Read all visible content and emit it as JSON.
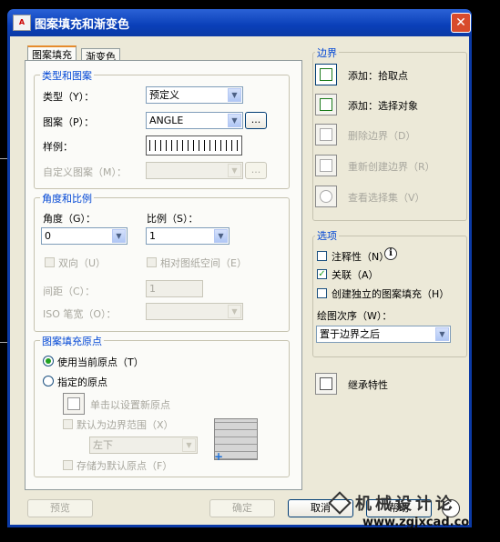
{
  "window": {
    "title": "图案填充和渐变色",
    "app_icon_text": "A"
  },
  "tabs": [
    {
      "label": "图案填充"
    },
    {
      "label": "渐变色"
    }
  ],
  "type_pattern": {
    "title": "类型和图案",
    "type_label": "类型（Y）：",
    "type_value": "预定义",
    "pattern_label": "图案（P）：",
    "pattern_value": "ANGLE",
    "pattern_browse": "...",
    "sample_label": "样例：",
    "custom_label": "自定义图案（M）：",
    "custom_browse": "..."
  },
  "angle_scale": {
    "title": "角度和比例",
    "angle_label": "角度（G）：",
    "angle_value": "0",
    "scale_label": "比例（S）：",
    "scale_value": "1",
    "double_label": "双向（U）",
    "relative_label": "相对图纸空间（E）",
    "spacing_label": "间距（C）：",
    "spacing_value": "1",
    "iso_label": "ISO 笔宽（O）："
  },
  "origin": {
    "title": "图案填充原点",
    "use_current": "使用当前原点（T）",
    "specified": "指定的原点",
    "click_set": "单击以设置新原点",
    "default_extent": "默认为边界范围（X）",
    "extent_value": "左下",
    "store_default": "存储为默认原点（F）"
  },
  "boundaries": {
    "title": "边界",
    "add_pick": "添加：拾取点",
    "add_select": "添加：选择对象",
    "remove": "删除边界（D）",
    "recreate": "重新创建边界（R）",
    "view": "查看选择集（V）"
  },
  "options": {
    "title": "选项",
    "annotative": "注释性（N）",
    "associative": "关联（A）",
    "separate": "创建独立的图案填充（H）",
    "draw_order_label": "绘图次序（W）：",
    "draw_order_value": "置于边界之后"
  },
  "inherit": {
    "label": "继承特性"
  },
  "footer": {
    "preview": "预览",
    "ok": "确定",
    "cancel": "取消",
    "help": "帮助"
  },
  "watermark": {
    "line1": "机械设计论",
    "line2": "www.zgjxcad.co"
  }
}
